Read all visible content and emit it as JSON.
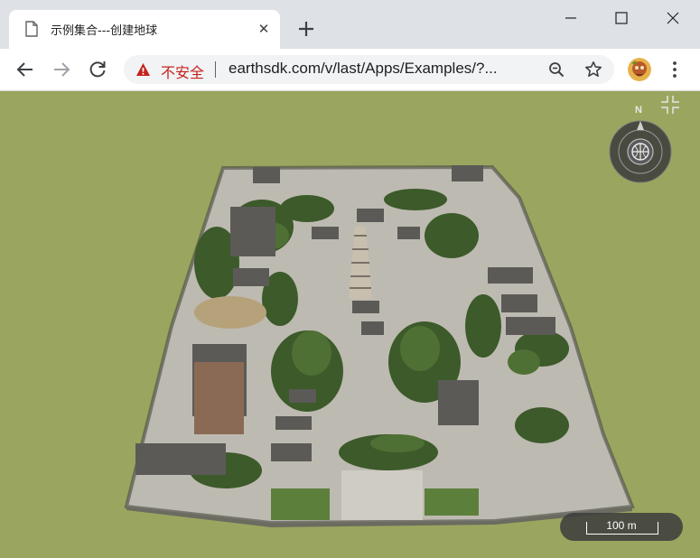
{
  "tab": {
    "title": "示例集合---创建地球",
    "close_glyph": "✕",
    "favicon_icon": "document-icon"
  },
  "window": {
    "minimize_icon": "minimize-icon",
    "maximize_icon": "maximize-icon",
    "close_icon": "close-icon",
    "new_tab_icon": "plus-icon"
  },
  "toolbar": {
    "back_icon": "arrow-left-icon",
    "forward_icon": "arrow-right-icon",
    "reload_icon": "reload-icon",
    "security_label": "不安全",
    "security_icon": "warning-icon",
    "url": "earthsdk.com/v/last/Apps/Examples/?...",
    "zoom_icon": "zoom-icon",
    "bookmark_icon": "star-icon",
    "menu_icon": "kebab-menu-icon"
  },
  "map": {
    "compass_label": "N",
    "scale_label": "100 m",
    "fullscreen_icon": "fullscreen-icon"
  },
  "colors": {
    "chrome_bg": "#dee1e6",
    "insecure_red": "#c5221f",
    "ground": "#9aa65f"
  }
}
